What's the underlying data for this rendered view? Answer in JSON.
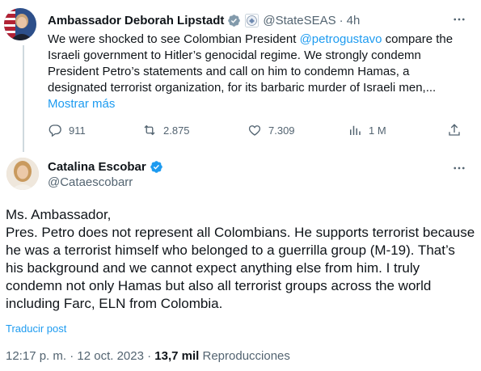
{
  "parent_tweet": {
    "author_name": "Ambassador Deborah Lipstadt",
    "handle": "@StateSEAS",
    "separator": "·",
    "time": "4h",
    "text_before_mention": "We were shocked to see Colombian President ",
    "mention": "@petrogustavo",
    "text_after_mention": " compare the Israeli government to Hitler’s genocidal regime. We strongly condemn President Petro’s statements and call on him to condemn Hamas, a designated terrorist organization, for its barbaric murder of Israeli men,...",
    "show_more": "Mostrar más",
    "replies": "911",
    "reposts": "2.875",
    "likes": "7.309",
    "views": "1 M"
  },
  "main_tweet": {
    "author_name": "Catalina Escobar",
    "handle": "@Cataescobarr",
    "text": "Ms. Ambassador,\nPres. Petro does not represent all Colombians. He supports terrorist because he was a terrorist himself who belonged to a guerrilla group (M-19). That’s his background and we cannot expect anything else from him. I truly condemn not only Hamas but also all terrorist groups across the world including Farc, ELN from Colombia.",
    "translate": "Traducir post",
    "timestamp": "12:17 p. m. · 12 oct. 2023 · ",
    "views_count": "13,7 mil",
    "views_label": " Reproducciones"
  },
  "icons": [
    "verified-badge-icon",
    "government-seal-icon",
    "more-icon",
    "reply-icon",
    "repost-icon",
    "like-icon",
    "views-icon",
    "share-icon"
  ],
  "colors": {
    "accent": "#1d9bf0",
    "secondary_text": "#536471",
    "text": "#0f1419",
    "divider": "#cfd9de"
  }
}
